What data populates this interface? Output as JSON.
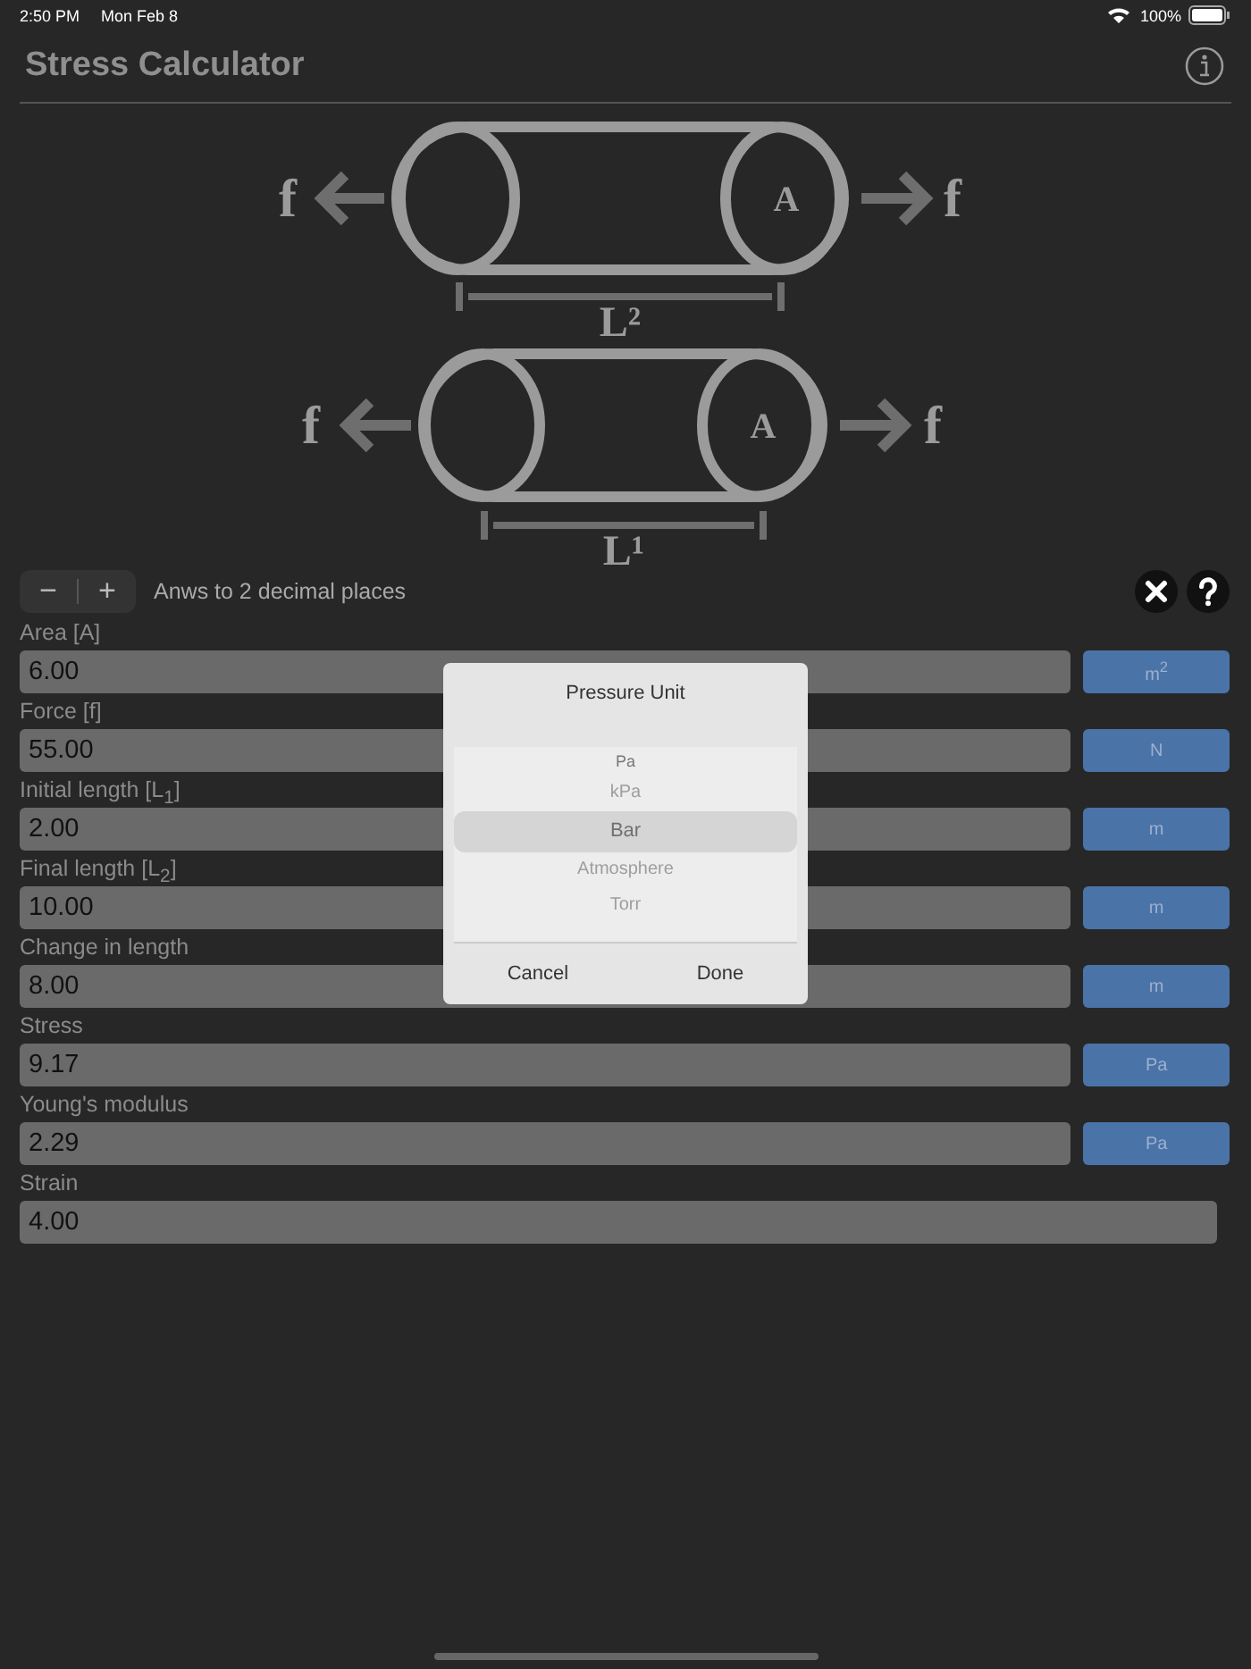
{
  "status_bar": {
    "time": "2:50 PM",
    "date": "Mon Feb 8",
    "battery": "100%"
  },
  "header": {
    "title": "Stress Calculator"
  },
  "diagram": {
    "cylinders": [
      {
        "force_left": "f",
        "area": "A",
        "force_right": "f",
        "length": "L²"
      },
      {
        "force_left": "f",
        "area": "A",
        "force_right": "f",
        "length": "L¹"
      }
    ]
  },
  "precision": {
    "decrease": "−",
    "increase": "+",
    "label": "Anws to 2 decimal places"
  },
  "fields": [
    {
      "label": "Area [A]",
      "value": "6.00",
      "unit": "m$^{2}$"
    },
    {
      "label": "Force [f]",
      "value": "55.00",
      "unit": "N"
    },
    {
      "label": "Initial length [L$_{1}$]",
      "value": "2.00",
      "unit": "m"
    },
    {
      "label": "Final length [L$_{2}$]",
      "value": "10.00",
      "unit": "m"
    },
    {
      "label": "Change in length",
      "value": "8.00",
      "unit": "m"
    },
    {
      "label": "Stress",
      "value": "9.17",
      "unit": "Pa"
    },
    {
      "label": "Young's modulus",
      "value": "2.29",
      "unit": "Pa"
    },
    {
      "label": "Strain",
      "value": "4.00"
    }
  ],
  "picker": {
    "title": "Pressure Unit",
    "options": [
      {
        "label": "Pa",
        "selected": false
      },
      {
        "label": "kPa",
        "selected": false
      },
      {
        "label": "Bar",
        "selected": true
      },
      {
        "label": "Atmosphere",
        "selected": false
      },
      {
        "label": "Torr",
        "selected": false
      }
    ],
    "buttons": [
      "Cancel",
      "Done"
    ]
  }
}
